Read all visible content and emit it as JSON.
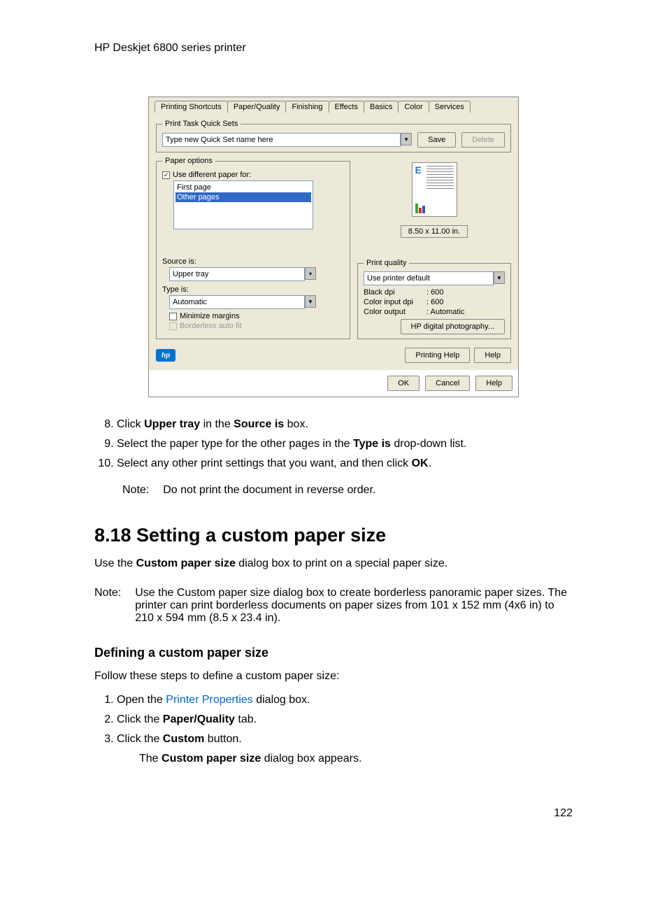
{
  "header": {
    "title": "HP Deskjet 6800 series printer"
  },
  "dialog": {
    "tabs": {
      "printing_shortcuts": "Printing Shortcuts",
      "paper_quality": "Paper/Quality",
      "finishing": "Finishing",
      "effects": "Effects",
      "basics": "Basics",
      "color": "Color",
      "services": "Services"
    },
    "quickset": {
      "legend": "Print Task Quick Sets",
      "placeholder": "Type new Quick Set name here",
      "save": "Save",
      "delete": "Delete"
    },
    "paper_options": {
      "legend": "Paper options",
      "use_different": "Use different paper for:",
      "first_page": "First page",
      "other_pages": "Other pages",
      "source_label": "Source is:",
      "source_value": "Upper tray",
      "type_label": "Type is:",
      "type_value": "Automatic",
      "minimize_margins": "Minimize margins",
      "borderless": "Borderless auto fit"
    },
    "preview": {
      "e": "E",
      "size": "8.50 x 11.00 in."
    },
    "print_quality": {
      "legend": "Print quality",
      "value": "Use printer default",
      "black_dpi_label": "Black dpi",
      "black_dpi_value": ": 600",
      "color_input_label": "Color input dpi",
      "color_input_value": ": 600",
      "color_output_label": "Color output",
      "color_output_value": ": Automatic",
      "hp_digital": "HP digital photography..."
    },
    "buttons": {
      "printing_help": "Printing Help",
      "help": "Help",
      "ok": "OK",
      "cancel": "Cancel",
      "help2": "Help",
      "hp": "hp"
    }
  },
  "steps1": {
    "s8_pre": "Click ",
    "s8_b1": "Upper tray",
    "s8_mid": " in the ",
    "s8_b2": "Source is",
    "s8_post": " box.",
    "s9_pre": "Select the paper type for the other pages in the ",
    "s9_b": "Type is",
    "s9_post": " drop-down list.",
    "s10_pre": "Select any other print settings that you want, and then click ",
    "s10_b": "OK",
    "s10_post": "."
  },
  "note1": {
    "label": "Note:",
    "text": "Do not print the document in reverse order."
  },
  "section": {
    "title": "8.18   Setting a custom paper size",
    "intro_pre": "Use the ",
    "intro_b": "Custom paper size",
    "intro_post": " dialog box to print on a special paper size."
  },
  "note2": {
    "label": "Note:",
    "text": "Use the Custom paper size dialog box to create borderless panoramic paper sizes. The printer can print borderless documents on paper sizes from 101 x 152 mm (4x6 in) to 210 x 594 mm (8.5 x 23.4 in)."
  },
  "subsection": {
    "title": "Defining a custom paper size",
    "intro": "Follow these steps to define a custom paper size:"
  },
  "steps2": {
    "s1_pre": "Open the ",
    "s1_link": "Printer Properties",
    "s1_post": " dialog box.",
    "s2_pre": "Click the ",
    "s2_b": "Paper/Quality",
    "s2_post": " tab.",
    "s3_pre": "Click the ",
    "s3_b": "Custom",
    "s3_post": " button.",
    "s3_after_pre": "The ",
    "s3_after_b": "Custom paper size",
    "s3_after_post": " dialog box appears."
  },
  "page_num": "122"
}
